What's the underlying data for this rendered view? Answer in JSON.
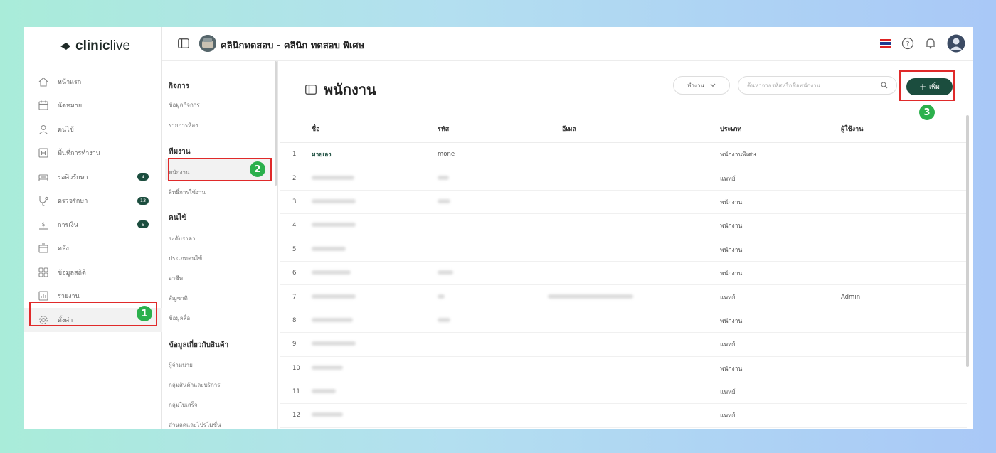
{
  "brand": {
    "logo_prefix": "clinic",
    "logo_suffix": "live"
  },
  "topbar": {
    "title": "คลินิกทดสอบ - คลินิก ทดสอบ พิเศษ"
  },
  "nav": {
    "items": [
      {
        "label": "หน้าแรก",
        "icon": "home-icon"
      },
      {
        "label": "นัดหมาย",
        "icon": "calendar-icon"
      },
      {
        "label": "คนไข้",
        "icon": "user-icon"
      },
      {
        "label": "พื้นที่การทำงาน",
        "icon": "workspace-icon"
      },
      {
        "label": "รอคิวรักษา",
        "icon": "bed-icon",
        "badge": "4"
      },
      {
        "label": "ตรวจรักษา",
        "icon": "stethoscope-icon",
        "badge": "13"
      },
      {
        "label": "การเงิน",
        "icon": "money-icon",
        "badge": "6"
      },
      {
        "label": "คลัง",
        "icon": "box-icon"
      },
      {
        "label": "ข้อมูลสถิติ",
        "icon": "stats-icon"
      },
      {
        "label": "รายงาน",
        "icon": "report-icon"
      },
      {
        "label": "ตั้งค่า",
        "icon": "gear-icon"
      }
    ]
  },
  "submenu": {
    "sections": [
      {
        "title": "กิจการ",
        "items": [
          "ข้อมูลกิจการ",
          "รายการห้อง"
        ]
      },
      {
        "title": "ทีมงาน",
        "items": [
          "พนักงาน",
          "สิทธิ์การใช้งาน"
        ]
      },
      {
        "title": "คนไข้",
        "items": [
          "ระดับราคา",
          "ประเภทคนไข้",
          "อาชีพ",
          "สัญชาติ",
          "ข้อมูลสื่อ"
        ]
      },
      {
        "title": "ข้อมูลเกี่ยวกับสินค้า",
        "items": [
          "ผู้จำหน่าย",
          "กลุ่มสินค้าและบริการ",
          "กลุ่มใบเสร็จ",
          "ส่วนลดและโปรโมชั่น"
        ]
      }
    ]
  },
  "main": {
    "title": "พนักงาน",
    "filter_label": "ทำงาน",
    "search_placeholder": "ค้นหาจากรหัสหรือชื่อพนักงาน",
    "add_label": "เพิ่ม",
    "columns": {
      "name": "ชื่อ",
      "code": "รหัส",
      "email": "อีเมล",
      "type": "ประเภท",
      "user": "ผู้ใช้งาน"
    },
    "rows": [
      {
        "idx": "1",
        "name": "มายเอง",
        "code": "mone",
        "type": "พนักงานพิเศษ",
        "user": ""
      },
      {
        "idx": "2",
        "type": "แพทย์",
        "user": ""
      },
      {
        "idx": "3",
        "type": "พนักงาน",
        "user": ""
      },
      {
        "idx": "4",
        "type": "พนักงาน",
        "user": ""
      },
      {
        "idx": "5",
        "type": "พนักงาน",
        "user": ""
      },
      {
        "idx": "6",
        "type": "พนักงาน",
        "user": ""
      },
      {
        "idx": "7",
        "type": "แพทย์",
        "user": "Admin"
      },
      {
        "idx": "8",
        "type": "พนักงาน",
        "user": ""
      },
      {
        "idx": "9",
        "type": "แพทย์",
        "user": ""
      },
      {
        "idx": "10",
        "type": "พนักงาน",
        "user": ""
      },
      {
        "idx": "11",
        "type": "แพทย์",
        "user": ""
      },
      {
        "idx": "12",
        "type": "แพทย์",
        "user": ""
      }
    ]
  },
  "annotations": {
    "step1": "1",
    "step2": "2",
    "step3": "3"
  },
  "colors": {
    "primary": "#1b4d3e",
    "highlight": "#e02a2a",
    "step": "#2bb04c"
  }
}
